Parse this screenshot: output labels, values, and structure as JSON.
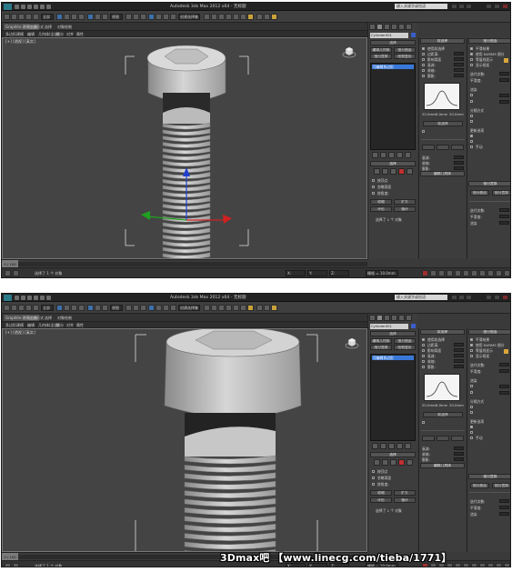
{
  "shots": [
    {
      "title": "Autodesk 3ds Max 2012 x64  -  无标题",
      "search_placeholder": "键入关键字或短语",
      "toolbar": {
        "combo_all": "全部",
        "combo_view": "视图",
        "combo_sel": "创建选择集"
      },
      "ribbon_tabs": [
        "Graphite 建模工具",
        "自由形式",
        "选择",
        "对象绘制"
      ],
      "ribbon_sub": [
        "多边形建模",
        "编辑",
        "几何体(全部)",
        "细分",
        "对齐",
        "属性"
      ],
      "viewport_label": "[+] [透视] [真实]",
      "modifier_panel": {
        "object_name": "Cylinder001",
        "stack_item": "可编辑多边形",
        "buttons": [
          "选择",
          "编辑几何体",
          "细分曲面",
          "细分置换",
          "绘制变形"
        ],
        "left_labels": [
          "使用 NURMS",
          "平滑结果",
          "迭代次数:",
          "平滑度:"
        ],
        "selection": [
          "按顶点",
          "忽略背面",
          "按角度:",
          "收缩",
          "扩大",
          "环形",
          "循环"
        ]
      },
      "soft_selection": {
        "title": "软选择",
        "labels": [
          "使用软选择",
          "边距离:",
          "影响背面",
          "衰减:",
          "收缩:",
          "膨胀:"
        ],
        "curve_labels": [
          "20.0mm",
          "0.0mm",
          "20.0mm"
        ]
      },
      "paint_deform": {
        "title": "细分曲面",
        "labels": [
          "平滑结果",
          "使用 NURMS 细分",
          "等值线显示",
          "显示框架",
          "迭代次数:",
          "平滑度:",
          "渲染",
          "分隔方式",
          "更新选项",
          "手动"
        ]
      },
      "status": {
        "message": "选择了 1 个 对象",
        "x": "X:",
        "y": "Y:",
        "z": "Z:",
        "grid": "栅格 = 10.0mm",
        "frames": "0 / 100"
      }
    },
    {
      "title": "Autodesk 3ds Max 2012 x64  -  无标题",
      "search_placeholder": "键入关键字或短语",
      "toolbar": {
        "combo_all": "全部",
        "combo_view": "视图",
        "combo_sel": "创建选择集"
      },
      "ribbon_tabs": [
        "Graphite 建模工具",
        "自由形式",
        "选择",
        "对象绘制"
      ],
      "ribbon_sub": [
        "多边形建模",
        "编辑",
        "几何体(全部)",
        "细分",
        "对齐",
        "属性"
      ],
      "viewport_label": "[+] [透视] [真实]",
      "modifier_panel": {
        "object_name": "Cylinder001",
        "stack_item": "可编辑多边形",
        "buttons": [
          "选择",
          "编辑几何体",
          "细分曲面",
          "细分置换",
          "绘制变形"
        ],
        "left_labels": [
          "使用 NURMS",
          "平滑结果",
          "迭代次数:",
          "平滑度:"
        ],
        "selection": [
          "按顶点",
          "忽略背面",
          "按角度:",
          "收缩",
          "扩大",
          "环形",
          "循环"
        ]
      },
      "soft_selection": {
        "title": "软选择",
        "labels": [
          "使用软选择",
          "边距离:",
          "影响背面",
          "衰减:",
          "收缩:",
          "膨胀:"
        ],
        "curve_labels": [
          "20.0mm",
          "0.0mm",
          "20.0mm"
        ]
      },
      "paint_deform": {
        "title": "细分曲面",
        "labels": [
          "平滑结果",
          "使用 NURMS 细分",
          "等值线显示",
          "显示框架",
          "迭代次数:",
          "平滑度:",
          "渲染",
          "分隔方式",
          "更新选项",
          "手动"
        ]
      },
      "status": {
        "message": "选择了 1 个 对象",
        "x": "X:",
        "y": "Y:",
        "z": "Z:",
        "grid": "栅格 = 10.0mm",
        "frames": "0 / 100"
      }
    }
  ],
  "watermark": "3Dmax吧 【www.linecg.com/tieba/1771】",
  "colors": {
    "viewport_bg": "#444444",
    "selection_blue": "#3978d8",
    "gizmo_x": "#d02020",
    "gizmo_y": "#20a020",
    "gizmo_z": "#2040d0",
    "bracket": "#dcdcdc"
  },
  "icons": [
    "3dsmax-logo-icon",
    "undo-icon",
    "redo-icon",
    "select-icon",
    "move-icon",
    "rotate-icon",
    "scale-icon",
    "snap-icon",
    "render-icon",
    "viewcube-icon",
    "play-icon"
  ]
}
